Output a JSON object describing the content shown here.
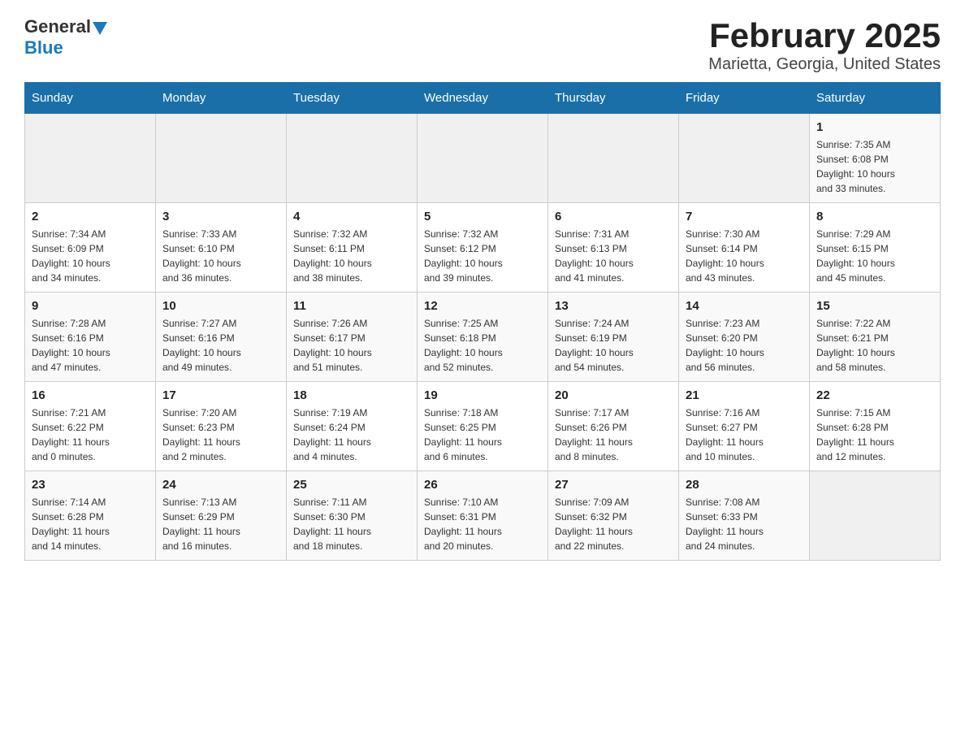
{
  "header": {
    "logo_general": "General",
    "logo_blue": "Blue",
    "title": "February 2025",
    "subtitle": "Marietta, Georgia, United States"
  },
  "weekdays": [
    "Sunday",
    "Monday",
    "Tuesday",
    "Wednesday",
    "Thursday",
    "Friday",
    "Saturday"
  ],
  "weeks": [
    [
      {
        "day": "",
        "info": ""
      },
      {
        "day": "",
        "info": ""
      },
      {
        "day": "",
        "info": ""
      },
      {
        "day": "",
        "info": ""
      },
      {
        "day": "",
        "info": ""
      },
      {
        "day": "",
        "info": ""
      },
      {
        "day": "1",
        "info": "Sunrise: 7:35 AM\nSunset: 6:08 PM\nDaylight: 10 hours\nand 33 minutes."
      }
    ],
    [
      {
        "day": "2",
        "info": "Sunrise: 7:34 AM\nSunset: 6:09 PM\nDaylight: 10 hours\nand 34 minutes."
      },
      {
        "day": "3",
        "info": "Sunrise: 7:33 AM\nSunset: 6:10 PM\nDaylight: 10 hours\nand 36 minutes."
      },
      {
        "day": "4",
        "info": "Sunrise: 7:32 AM\nSunset: 6:11 PM\nDaylight: 10 hours\nand 38 minutes."
      },
      {
        "day": "5",
        "info": "Sunrise: 7:32 AM\nSunset: 6:12 PM\nDaylight: 10 hours\nand 39 minutes."
      },
      {
        "day": "6",
        "info": "Sunrise: 7:31 AM\nSunset: 6:13 PM\nDaylight: 10 hours\nand 41 minutes."
      },
      {
        "day": "7",
        "info": "Sunrise: 7:30 AM\nSunset: 6:14 PM\nDaylight: 10 hours\nand 43 minutes."
      },
      {
        "day": "8",
        "info": "Sunrise: 7:29 AM\nSunset: 6:15 PM\nDaylight: 10 hours\nand 45 minutes."
      }
    ],
    [
      {
        "day": "9",
        "info": "Sunrise: 7:28 AM\nSunset: 6:16 PM\nDaylight: 10 hours\nand 47 minutes."
      },
      {
        "day": "10",
        "info": "Sunrise: 7:27 AM\nSunset: 6:16 PM\nDaylight: 10 hours\nand 49 minutes."
      },
      {
        "day": "11",
        "info": "Sunrise: 7:26 AM\nSunset: 6:17 PM\nDaylight: 10 hours\nand 51 minutes."
      },
      {
        "day": "12",
        "info": "Sunrise: 7:25 AM\nSunset: 6:18 PM\nDaylight: 10 hours\nand 52 minutes."
      },
      {
        "day": "13",
        "info": "Sunrise: 7:24 AM\nSunset: 6:19 PM\nDaylight: 10 hours\nand 54 minutes."
      },
      {
        "day": "14",
        "info": "Sunrise: 7:23 AM\nSunset: 6:20 PM\nDaylight: 10 hours\nand 56 minutes."
      },
      {
        "day": "15",
        "info": "Sunrise: 7:22 AM\nSunset: 6:21 PM\nDaylight: 10 hours\nand 58 minutes."
      }
    ],
    [
      {
        "day": "16",
        "info": "Sunrise: 7:21 AM\nSunset: 6:22 PM\nDaylight: 11 hours\nand 0 minutes."
      },
      {
        "day": "17",
        "info": "Sunrise: 7:20 AM\nSunset: 6:23 PM\nDaylight: 11 hours\nand 2 minutes."
      },
      {
        "day": "18",
        "info": "Sunrise: 7:19 AM\nSunset: 6:24 PM\nDaylight: 11 hours\nand 4 minutes."
      },
      {
        "day": "19",
        "info": "Sunrise: 7:18 AM\nSunset: 6:25 PM\nDaylight: 11 hours\nand 6 minutes."
      },
      {
        "day": "20",
        "info": "Sunrise: 7:17 AM\nSunset: 6:26 PM\nDaylight: 11 hours\nand 8 minutes."
      },
      {
        "day": "21",
        "info": "Sunrise: 7:16 AM\nSunset: 6:27 PM\nDaylight: 11 hours\nand 10 minutes."
      },
      {
        "day": "22",
        "info": "Sunrise: 7:15 AM\nSunset: 6:28 PM\nDaylight: 11 hours\nand 12 minutes."
      }
    ],
    [
      {
        "day": "23",
        "info": "Sunrise: 7:14 AM\nSunset: 6:28 PM\nDaylight: 11 hours\nand 14 minutes."
      },
      {
        "day": "24",
        "info": "Sunrise: 7:13 AM\nSunset: 6:29 PM\nDaylight: 11 hours\nand 16 minutes."
      },
      {
        "day": "25",
        "info": "Sunrise: 7:11 AM\nSunset: 6:30 PM\nDaylight: 11 hours\nand 18 minutes."
      },
      {
        "day": "26",
        "info": "Sunrise: 7:10 AM\nSunset: 6:31 PM\nDaylight: 11 hours\nand 20 minutes."
      },
      {
        "day": "27",
        "info": "Sunrise: 7:09 AM\nSunset: 6:32 PM\nDaylight: 11 hours\nand 22 minutes."
      },
      {
        "day": "28",
        "info": "Sunrise: 7:08 AM\nSunset: 6:33 PM\nDaylight: 11 hours\nand 24 minutes."
      },
      {
        "day": "",
        "info": ""
      }
    ]
  ]
}
